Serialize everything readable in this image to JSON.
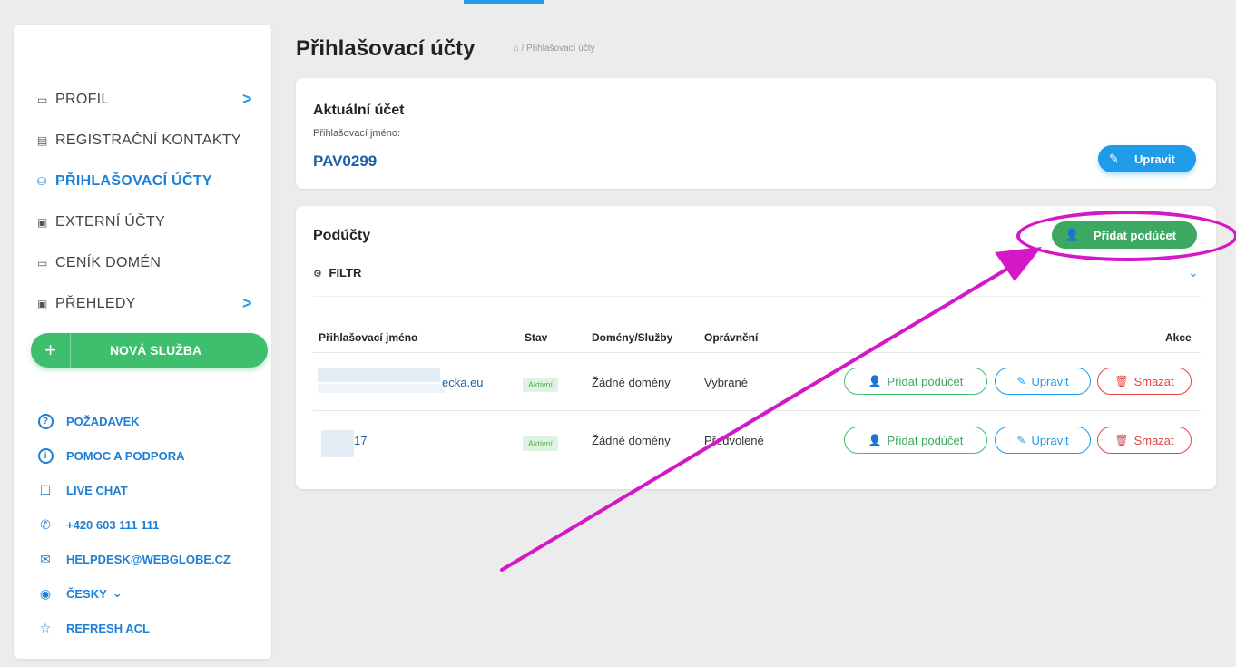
{
  "sidebar": {
    "nav": [
      {
        "label": "PROFIL",
        "icon": "id-card-icon",
        "glyph": "▭",
        "chevron": ">"
      },
      {
        "label": "REGISTRAČNÍ KONTAKTY",
        "icon": "contacts-list-icon",
        "glyph": "▤",
        "chevron": ""
      },
      {
        "label": "PŘIHLAŠOVACÍ ÚČTY",
        "icon": "users-icon",
        "glyph": "⛁",
        "chevron": "",
        "active": true
      },
      {
        "label": "EXTERNÍ ÚČTY",
        "icon": "window-icon",
        "glyph": "▣",
        "chevron": ""
      },
      {
        "label": "CENÍK DOMÉN",
        "icon": "price-tag-icon",
        "glyph": "▭",
        "chevron": ""
      },
      {
        "label": "PŘEHLEDY",
        "icon": "window-icon",
        "glyph": "▣",
        "chevron": ">"
      }
    ],
    "new_service": {
      "plus": "+",
      "label": "NOVÁ SLUŽBA"
    },
    "support": [
      {
        "label": "POŽADAVEK",
        "icon": "question-circle-icon",
        "glyph": "?"
      },
      {
        "label": "POMOC A PODPORA",
        "icon": "info-circle-icon",
        "glyph": "i"
      },
      {
        "label": "LIVE CHAT",
        "icon": "chat-bubble-icon",
        "glyph": "☐"
      },
      {
        "label": "+420 603 111 111",
        "icon": "phone-icon",
        "glyph": "✆"
      },
      {
        "label": "HELPDESK@WEBGLOBE.CZ",
        "icon": "mail-icon",
        "glyph": "✉"
      },
      {
        "label": "ČESKY",
        "icon": "globe-icon",
        "glyph": "◉",
        "chevron": "⌄"
      },
      {
        "label": "REFRESH ACL",
        "icon": "star-icon",
        "glyph": "☆"
      }
    ]
  },
  "main": {
    "title": "Přihlašovací účty",
    "breadcrumb_icon": "home-icon",
    "breadcrumb": "/ Přihlašovací účty",
    "current": {
      "title": "Aktuální účet",
      "label": "Přihlašovací jméno:",
      "login": "PAV0299",
      "edit_button": "Upravit"
    },
    "sub": {
      "title": "Podúčty",
      "add_button": "Přidat podúčet",
      "filter": "FILTR",
      "columns": [
        "Přihlašovací jméno",
        "Stav",
        "Domény/Služby",
        "Oprávnění",
        "Akce"
      ],
      "rows": [
        {
          "login": "ecka.eu",
          "status": "Aktivní",
          "domains": "Žádné domény",
          "rights": "Vybrané"
        },
        {
          "login": "17",
          "status": "Aktivní",
          "domains": "Žádné domény",
          "rights": "Předvolené"
        }
      ],
      "actions": {
        "add": "Přidat podúčet",
        "edit": "Upravit",
        "delete": "Smazat"
      }
    }
  },
  "colors": {
    "accent": "#1e9be9",
    "green": "#3dbf6e",
    "red": "#e5433f",
    "annotation": "#d418c8"
  }
}
